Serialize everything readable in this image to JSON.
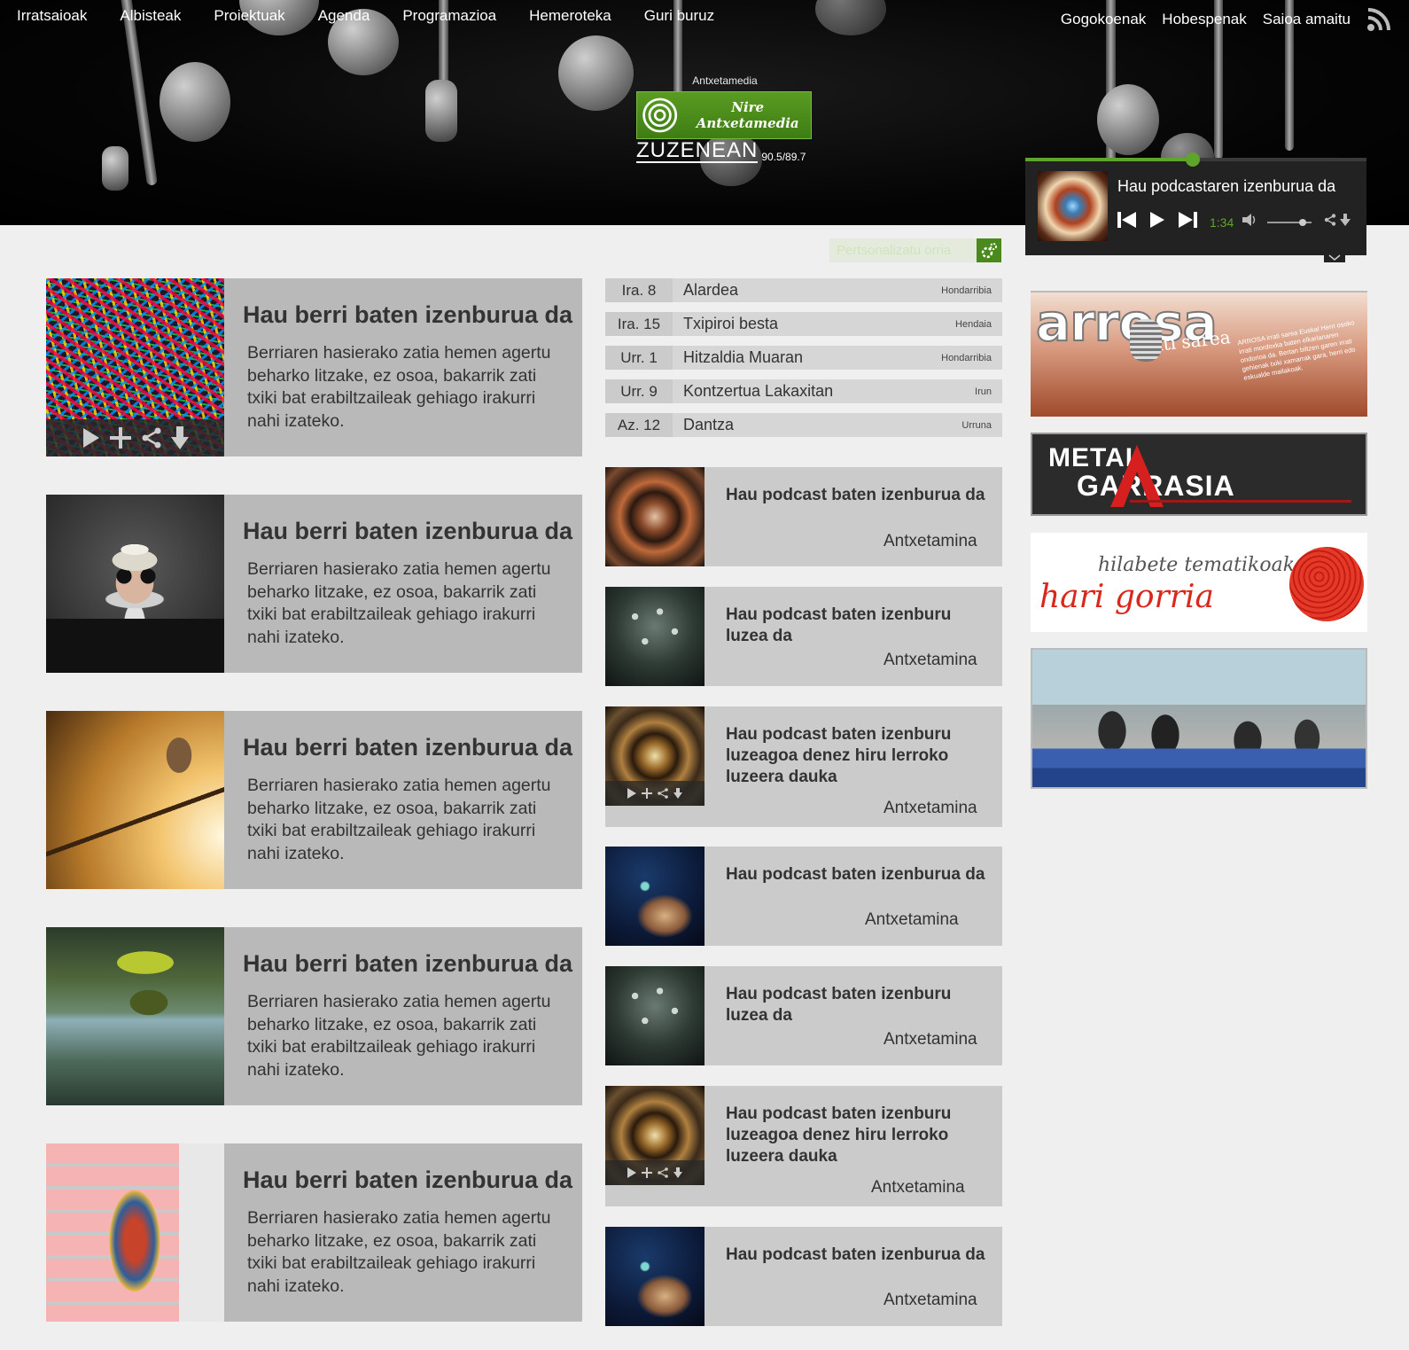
{
  "nav": {
    "left": [
      "Irratsaioak",
      "Albisteak",
      "Proiektuak",
      "Agenda",
      "Programazioa",
      "Hemeroteka",
      "Guri buruz"
    ],
    "right": [
      "Gogokoenak",
      "Hobespenak",
      "Saioa amaitu"
    ]
  },
  "logo": {
    "top_text": "Antxetamedia",
    "badge_text": "Nire Antxetamedia",
    "live_text": "ZUZENEAN",
    "frequency": "90.5/89.7"
  },
  "player": {
    "title": "Hau podcastaren izenburua da",
    "time": "1:34",
    "progress": 0.49,
    "volume": 0.8
  },
  "personalize": {
    "label": "Pertsonalizatu orria"
  },
  "news": [
    {
      "title": "Hau berri baten izenburua da",
      "text": "Berriaren hasierako zatia hemen agertu beharko litzake, ez osoa, bakarrik zati txiki bat erabiltzaileak gehiago  irakurri nahi izateko.",
      "image": "colorful-feathers"
    },
    {
      "title": "Hau berri baten izenburua da",
      "text": "Berriaren hasierako zatia hemen agertu beharko litzake, ez osoa, bakarrik zati txiki bat erabiltzaileak gehiago  irakurri nahi izateko.",
      "image": "bearded-man"
    },
    {
      "title": "Hau berri baten izenburua da",
      "text": "Berriaren hasierako zatia hemen agertu beharko litzake, ez osoa, bakarrik zati txiki bat erabiltzaileak gehiago  irakurri nahi izateko.",
      "image": "butterfly"
    },
    {
      "title": "Hau berri baten izenburua da",
      "text": "Berriaren hasierako zatia hemen agertu beharko litzake, ez osoa, bakarrik zati txiki bat erabiltzaileak gehiago  irakurri nahi izateko.",
      "image": "tree-on-lake"
    },
    {
      "title": "Hau berri baten izenburua da",
      "text": "Berriaren hasierako zatia hemen agertu beharko litzake, ez osoa, bakarrik zati txiki bat erabiltzaileak gehiago  irakurri nahi izateko.",
      "image": "mural-building"
    }
  ],
  "events": [
    {
      "date": "Ira. 8",
      "title": "Alardea",
      "place": "Hondarribia"
    },
    {
      "date": "Ira. 15",
      "title": "Txipiroi besta",
      "place": "Hendaia"
    },
    {
      "date": "Urr. 1",
      "title": "Hitzaldia Muaran",
      "place": "Hondarribia"
    },
    {
      "date": "Urr. 9",
      "title": "Kontzertua Lakaxitan",
      "place": "Irun"
    },
    {
      "date": "Az. 12",
      "title": "Dantza",
      "place": "Urruna"
    }
  ],
  "podcasts": [
    {
      "title": "Hau podcast baten  izenburua da",
      "author": "Antxetamina"
    },
    {
      "title": "Hau podcast baten  izenburu luzea da",
      "author": "Antxetamina"
    },
    {
      "title": "Hau podcast baten  izenburu luzeagoa denez hiru lerroko luzeera dauka",
      "author": "Antxetamina"
    },
    {
      "title": "Hau podcast baten  izenburua da",
      "author": "Antxetamina"
    },
    {
      "title": "Hau podcast baten  izenburu luzea da",
      "author": "Antxetamina"
    },
    {
      "title": "Hau podcast baten  izenburu luzeagoa denez hiru lerroko luzeera dauka",
      "author": "Antxetamina"
    },
    {
      "title": "Hau podcast baten  izenburua da",
      "author": "Antxetamina"
    }
  ],
  "banners": {
    "arrosa": {
      "logo": "arrosa",
      "subtitle": "irrati sarea",
      "text": "ARROSA irrati sarea Euskal Herri osoko irrati mordoxka baten elkarlanaren ondorioa da. Bertan biltzen garen irrati gehienak txiki xamarrak gara, herri edo eskualde mailakoak."
    },
    "metal": {
      "line1": "METAL",
      "line2": "GARRASIA"
    },
    "hari": {
      "line1": "hilabete  tematikoak",
      "line2": "hari gorria"
    },
    "conference": {
      "image": "conference-panel"
    }
  },
  "colors": {
    "accent": "#5fa52c",
    "header_bg": "#000000",
    "card_bg": "#b9b9b9",
    "pod_bg": "#cbcbcb"
  }
}
